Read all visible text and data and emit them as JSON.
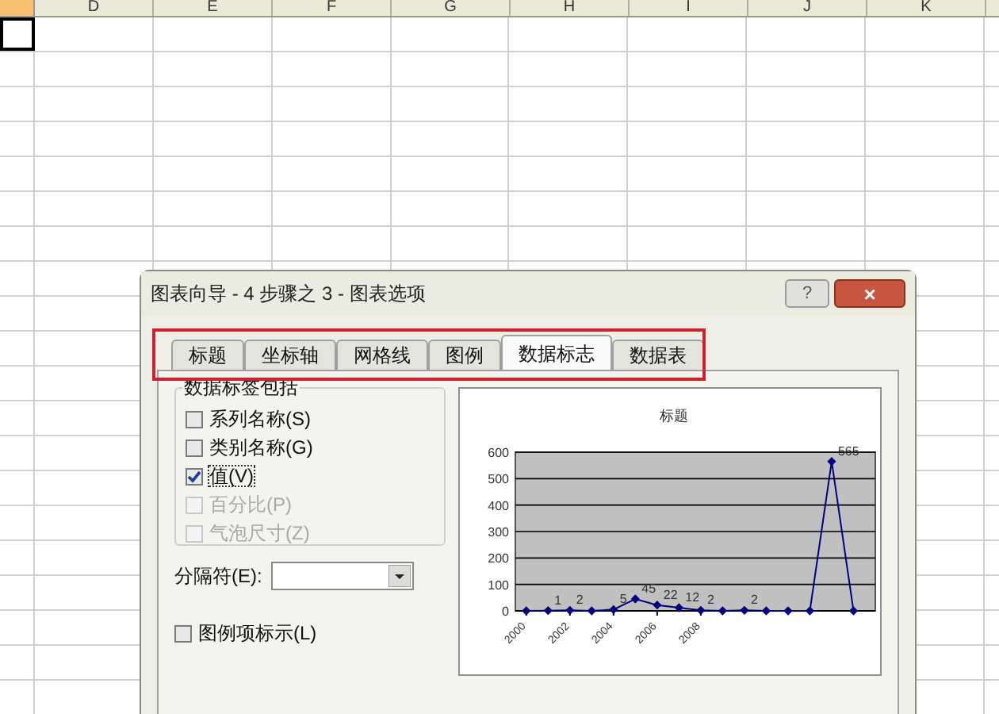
{
  "sheet": {
    "columns": [
      "D",
      "E",
      "F",
      "G",
      "H",
      "I",
      "J",
      "K"
    ]
  },
  "dialog": {
    "title": "图表向导 - 4 步骤之 3 - 图表选项",
    "help": "?",
    "close": "×",
    "tabs": [
      {
        "label": "标题",
        "selected": false
      },
      {
        "label": "坐标轴",
        "selected": false
      },
      {
        "label": "网格线",
        "selected": false
      },
      {
        "label": "图例",
        "selected": false
      },
      {
        "label": "数据标志",
        "selected": true
      },
      {
        "label": "数据表",
        "selected": false
      }
    ],
    "group": {
      "title": "数据标签包括",
      "options": [
        {
          "label": "系列名称(S)",
          "checked": false,
          "disabled": false,
          "focused": false
        },
        {
          "label": "类别名称(G)",
          "checked": false,
          "disabled": false,
          "focused": false
        },
        {
          "label": "值(V)",
          "checked": true,
          "disabled": false,
          "focused": true
        },
        {
          "label": "百分比(P)",
          "checked": false,
          "disabled": true,
          "focused": false
        },
        {
          "label": "气泡尺寸(Z)",
          "checked": false,
          "disabled": true,
          "focused": false
        }
      ]
    },
    "separator": {
      "label": "分隔符(E):"
    },
    "legend_key": {
      "label": "图例项标示(L)",
      "checked": false
    },
    "chart_data": {
      "type": "line",
      "title": "标题",
      "x": [
        2000,
        2001,
        2002,
        2003,
        2004,
        2005,
        2006,
        2007,
        2008,
        2009,
        2010,
        2011,
        2012,
        2013,
        2014,
        2015
      ],
      "series": [
        {
          "color": "#000080",
          "marker": "diamond",
          "values": [
            0,
            1,
            2,
            0,
            5,
            45,
            22,
            12,
            2,
            0,
            2,
            0,
            0,
            0,
            565,
            0
          ]
        }
      ],
      "ylim": [
        0,
        600
      ],
      "yticks": [
        0,
        100,
        200,
        300,
        400,
        500,
        600
      ],
      "xlim": [
        1999.5,
        2016
      ],
      "xticks": [
        2000,
        2002,
        2004,
        2006,
        2008
      ],
      "grid": true,
      "value_labels": [
        null,
        "1",
        "2",
        null,
        "5",
        "45",
        "22",
        "12",
        "2",
        null,
        "2",
        null,
        null,
        null,
        "565",
        null
      ]
    }
  }
}
